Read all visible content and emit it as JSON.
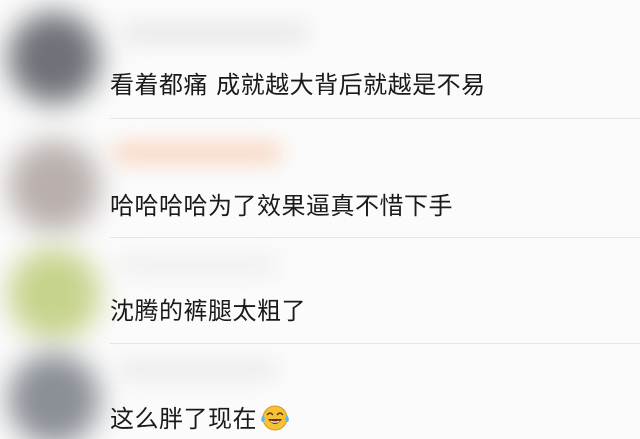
{
  "comments": [
    {
      "text": "看着都痛 成就越大背后就越是不易",
      "avatar_color": "#6f7379",
      "username_color": "#e9e9ea"
    },
    {
      "text": "哈哈哈哈为了效果逼真不惜下手",
      "avatar_color": "#b9b0ad",
      "username_color": "#f8d8c4"
    },
    {
      "text": "沈腾的裤腿太粗了",
      "avatar_color": "#c6d38c",
      "username_color": "#f0f0f0"
    },
    {
      "text": "这么胖了现在",
      "avatar_color": "#8b8f96",
      "username_color": "#ececec",
      "emoji": "laughing-tears-emoji"
    }
  ]
}
